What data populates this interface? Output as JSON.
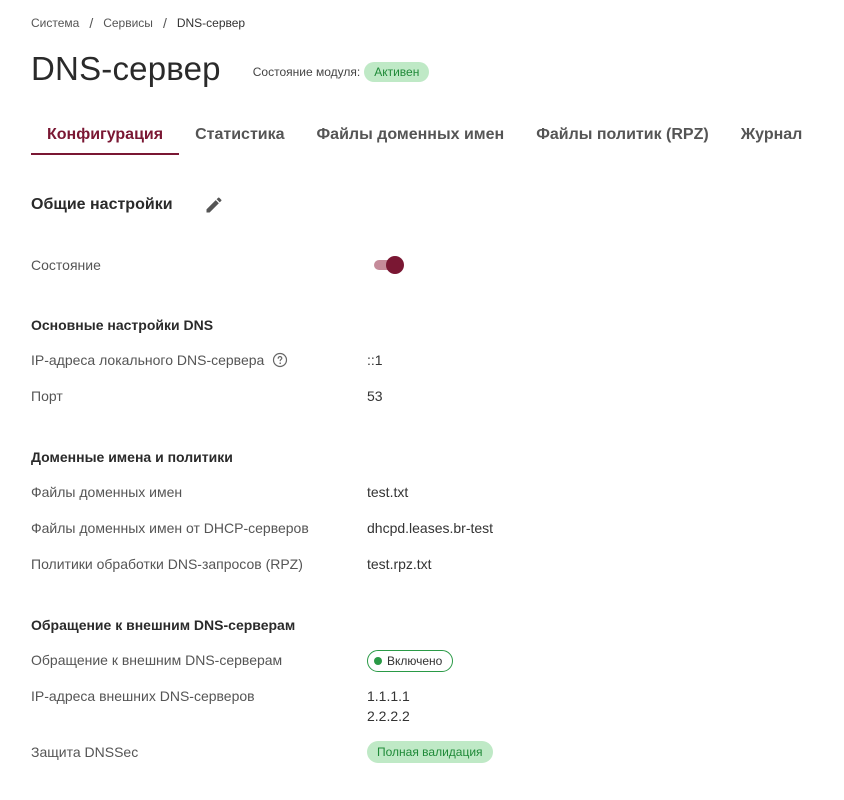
{
  "breadcrumb": {
    "item1": "Система",
    "item2": "Сервисы",
    "item3": "DNS-сервер",
    "separator": "/"
  },
  "header": {
    "title": "DNS-сервер",
    "module_state_label": "Состояние модуля:",
    "module_state_value": "Активен"
  },
  "tabs": [
    {
      "label": "Конфигурация",
      "active": true
    },
    {
      "label": "Статистика",
      "active": false
    },
    {
      "label": "Файлы доменных имен",
      "active": false
    },
    {
      "label": "Файлы политик (RPZ)",
      "active": false
    },
    {
      "label": "Журнал",
      "active": false
    }
  ],
  "general": {
    "title": "Общие настройки",
    "edit_icon": "pencil-icon",
    "state_label": "Состояние",
    "state_enabled": true
  },
  "dns_basic": {
    "title": "Основные настройки DNS",
    "local_ip_label": "IP-адреса локального DNS-сервера",
    "local_ip_value": "::1",
    "help_icon": "help-circle-icon",
    "port_label": "Порт",
    "port_value": "53"
  },
  "domains": {
    "title": "Доменные имена и политики",
    "domain_files_label": "Файлы доменных имен",
    "domain_files_value": "test.txt",
    "dhcp_files_label": "Файлы доменных имен от DHCP-серверов",
    "dhcp_files_value": "dhcpd.leases.br-test",
    "rpz_label": "Политики обработки DNS-запросов (RPZ)",
    "rpz_value": "test.rpz.txt"
  },
  "external": {
    "title": "Обращение к внешним DNS-серверам",
    "access_label": "Обращение к внешним DNS-серверам",
    "access_value": "Включено",
    "ips_label": "IP-адреса внешних DNS-серверов",
    "ips": [
      "1.1.1.1",
      "2.2.2.2"
    ],
    "dnssec_label": "Защита DNSSec",
    "dnssec_value": "Полная валидация"
  },
  "colors": {
    "accent": "#7a1733",
    "success_bg": "#bfe9c6",
    "success_text": "#1f8a38",
    "success_border": "#2a9a46"
  }
}
